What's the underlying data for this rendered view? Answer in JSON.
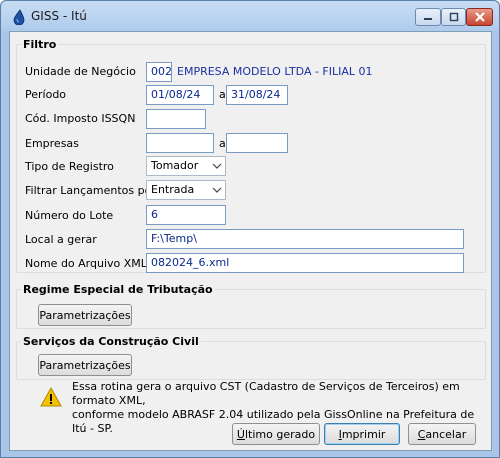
{
  "window": {
    "title": "GISS - Itú"
  },
  "filtro": {
    "legend": "Filtro",
    "unidade_negocio": {
      "label": "Unidade de Negócio",
      "code": "002",
      "name": "EMPRESA MODELO LTDA - FILIAL 01"
    },
    "periodo": {
      "label": "Período",
      "from": "01/08/24",
      "separator": "a",
      "to": "31/08/24"
    },
    "cod_imposto": {
      "label": "Cód. Imposto ISSQN",
      "value": ""
    },
    "empresas": {
      "label": "Empresas",
      "from": "",
      "separator": "a",
      "to": ""
    },
    "tipo_registro": {
      "label": "Tipo de Registro",
      "value": "Tomador"
    },
    "filtrar_lancamentos": {
      "label": "Filtrar Lançamentos por",
      "value": "Entrada"
    },
    "numero_lote": {
      "label": "Número do Lote",
      "value": "6"
    },
    "local_gerar": {
      "label": "Local a gerar",
      "value": "F:\\Temp\\"
    },
    "nome_arquivo": {
      "label": "Nome do Arquivo XML",
      "value": "082024_6.xml"
    }
  },
  "regime_especial": {
    "legend": "Regime Especial de Tributação",
    "button": "Parametrizações"
  },
  "servicos_construcao": {
    "legend": "Serviços da Construção Civil",
    "button": "Parametrizações"
  },
  "message": {
    "line1": "Essa rotina gera o arquivo CST (Cadastro de Serviços de Terceiros) em formato XML,",
    "line2": "conforme modelo ABRASF 2.04 utilizado pela GissOnline na Prefeitura de Itú - SP."
  },
  "buttons": {
    "ultimo_gerado": {
      "first": "Ú",
      "rest": "ltimo gerado"
    },
    "imprimir": {
      "first": "I",
      "rest": "mprimir"
    },
    "cancelar": {
      "first": "C",
      "rest": "ancelar"
    }
  },
  "colors": {
    "title_bar": "#aecbec",
    "input_text": "#0a2a8e",
    "close_button": "#c6452f",
    "warning": "#f2c200"
  }
}
